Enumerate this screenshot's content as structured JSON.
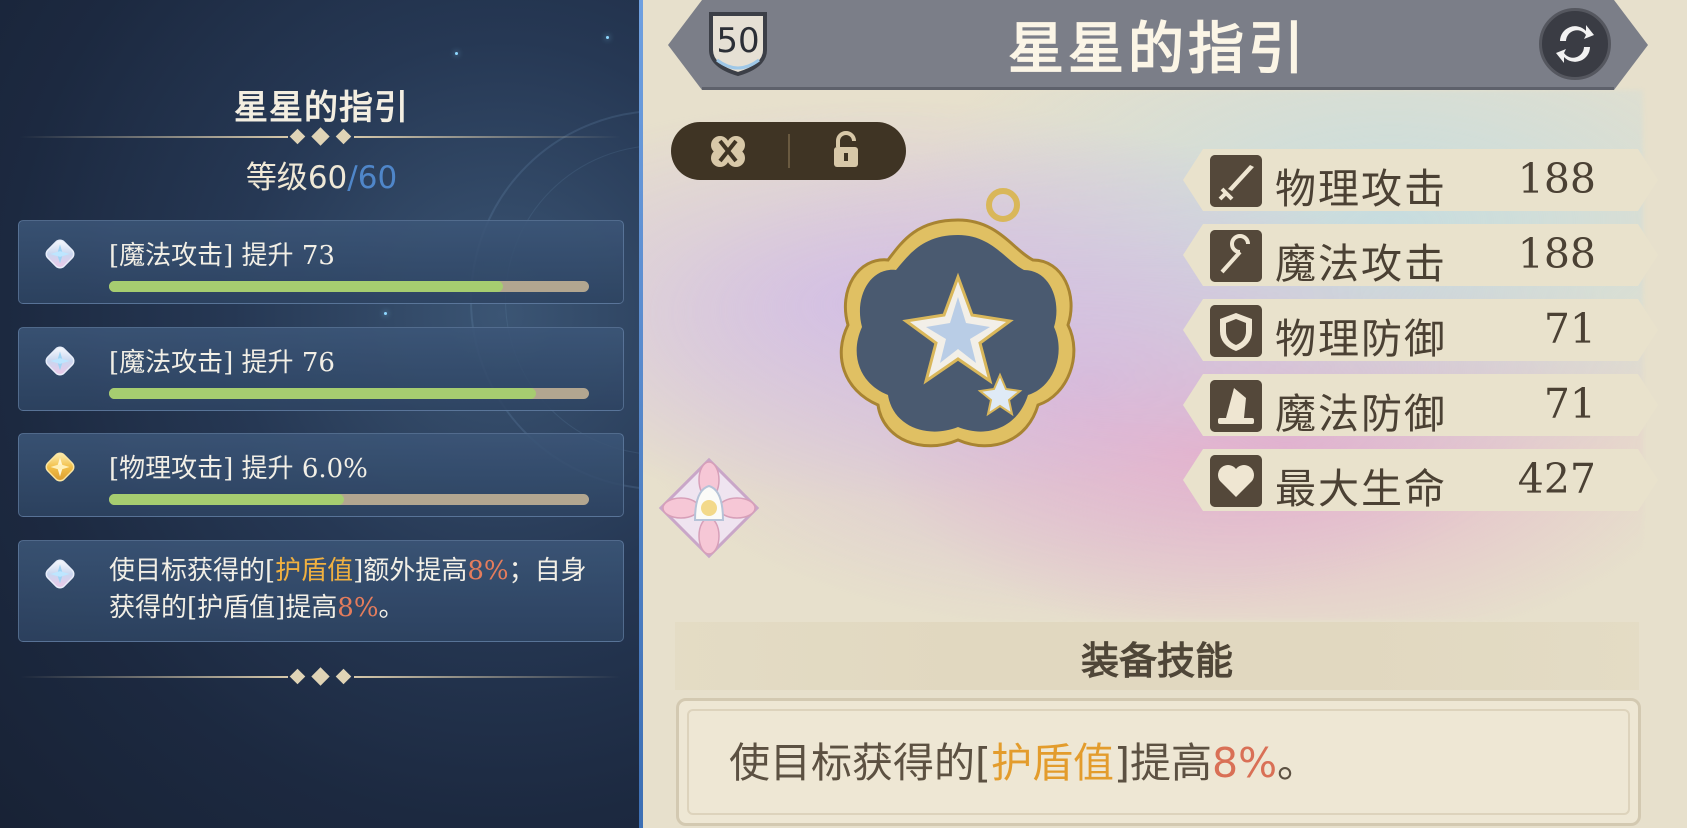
{
  "left_panel": {
    "title": "星星的指引",
    "level_label": "等级",
    "level_current": "60",
    "level_sep": "/",
    "level_max": "60",
    "substats": [
      {
        "text": "[魔法攻击] 提升 73",
        "gem": "silver-gem-icon",
        "progress": 0.82
      },
      {
        "text": "[魔法攻击] 提升 76",
        "gem": "silver-gem-icon",
        "progress": 0.89
      },
      {
        "text": "[物理攻击] 提升 6.0%",
        "gem": "gold-gem-icon",
        "progress": 0.49
      }
    ],
    "effect": {
      "part1": "使目标获得的[",
      "kw1": "护盾值",
      "part2": "]额外提高",
      "pct1": "8%",
      "part3": "；自身获得的[护盾值]提高",
      "pct2": "8%",
      "part4": "。"
    }
  },
  "right_panel": {
    "level_badge": "50",
    "title": "星星的指引",
    "stats": [
      {
        "name": "物理攻击",
        "value": "188",
        "icon": "sword-icon"
      },
      {
        "name": "魔法攻击",
        "value": "188",
        "icon": "staff-icon"
      },
      {
        "name": "物理防御",
        "value": "71",
        "icon": "shield-icon"
      },
      {
        "name": "魔法防御",
        "value": "71",
        "icon": "wizard-hat-icon"
      },
      {
        "name": "最大生命",
        "value": "427",
        "icon": "heart-icon"
      }
    ],
    "skill_header": "装备技能",
    "skill": {
      "part1": "使目标获得的[",
      "kw": "护盾值",
      "part2": "]提高",
      "pct": "8%",
      "part3": "。"
    }
  },
  "colors": {
    "accent_orange": "#f0b040",
    "accent_red": "#e47c5c",
    "progress_fill": "#a6cd70",
    "level_max_blue": "#4f86c9"
  }
}
